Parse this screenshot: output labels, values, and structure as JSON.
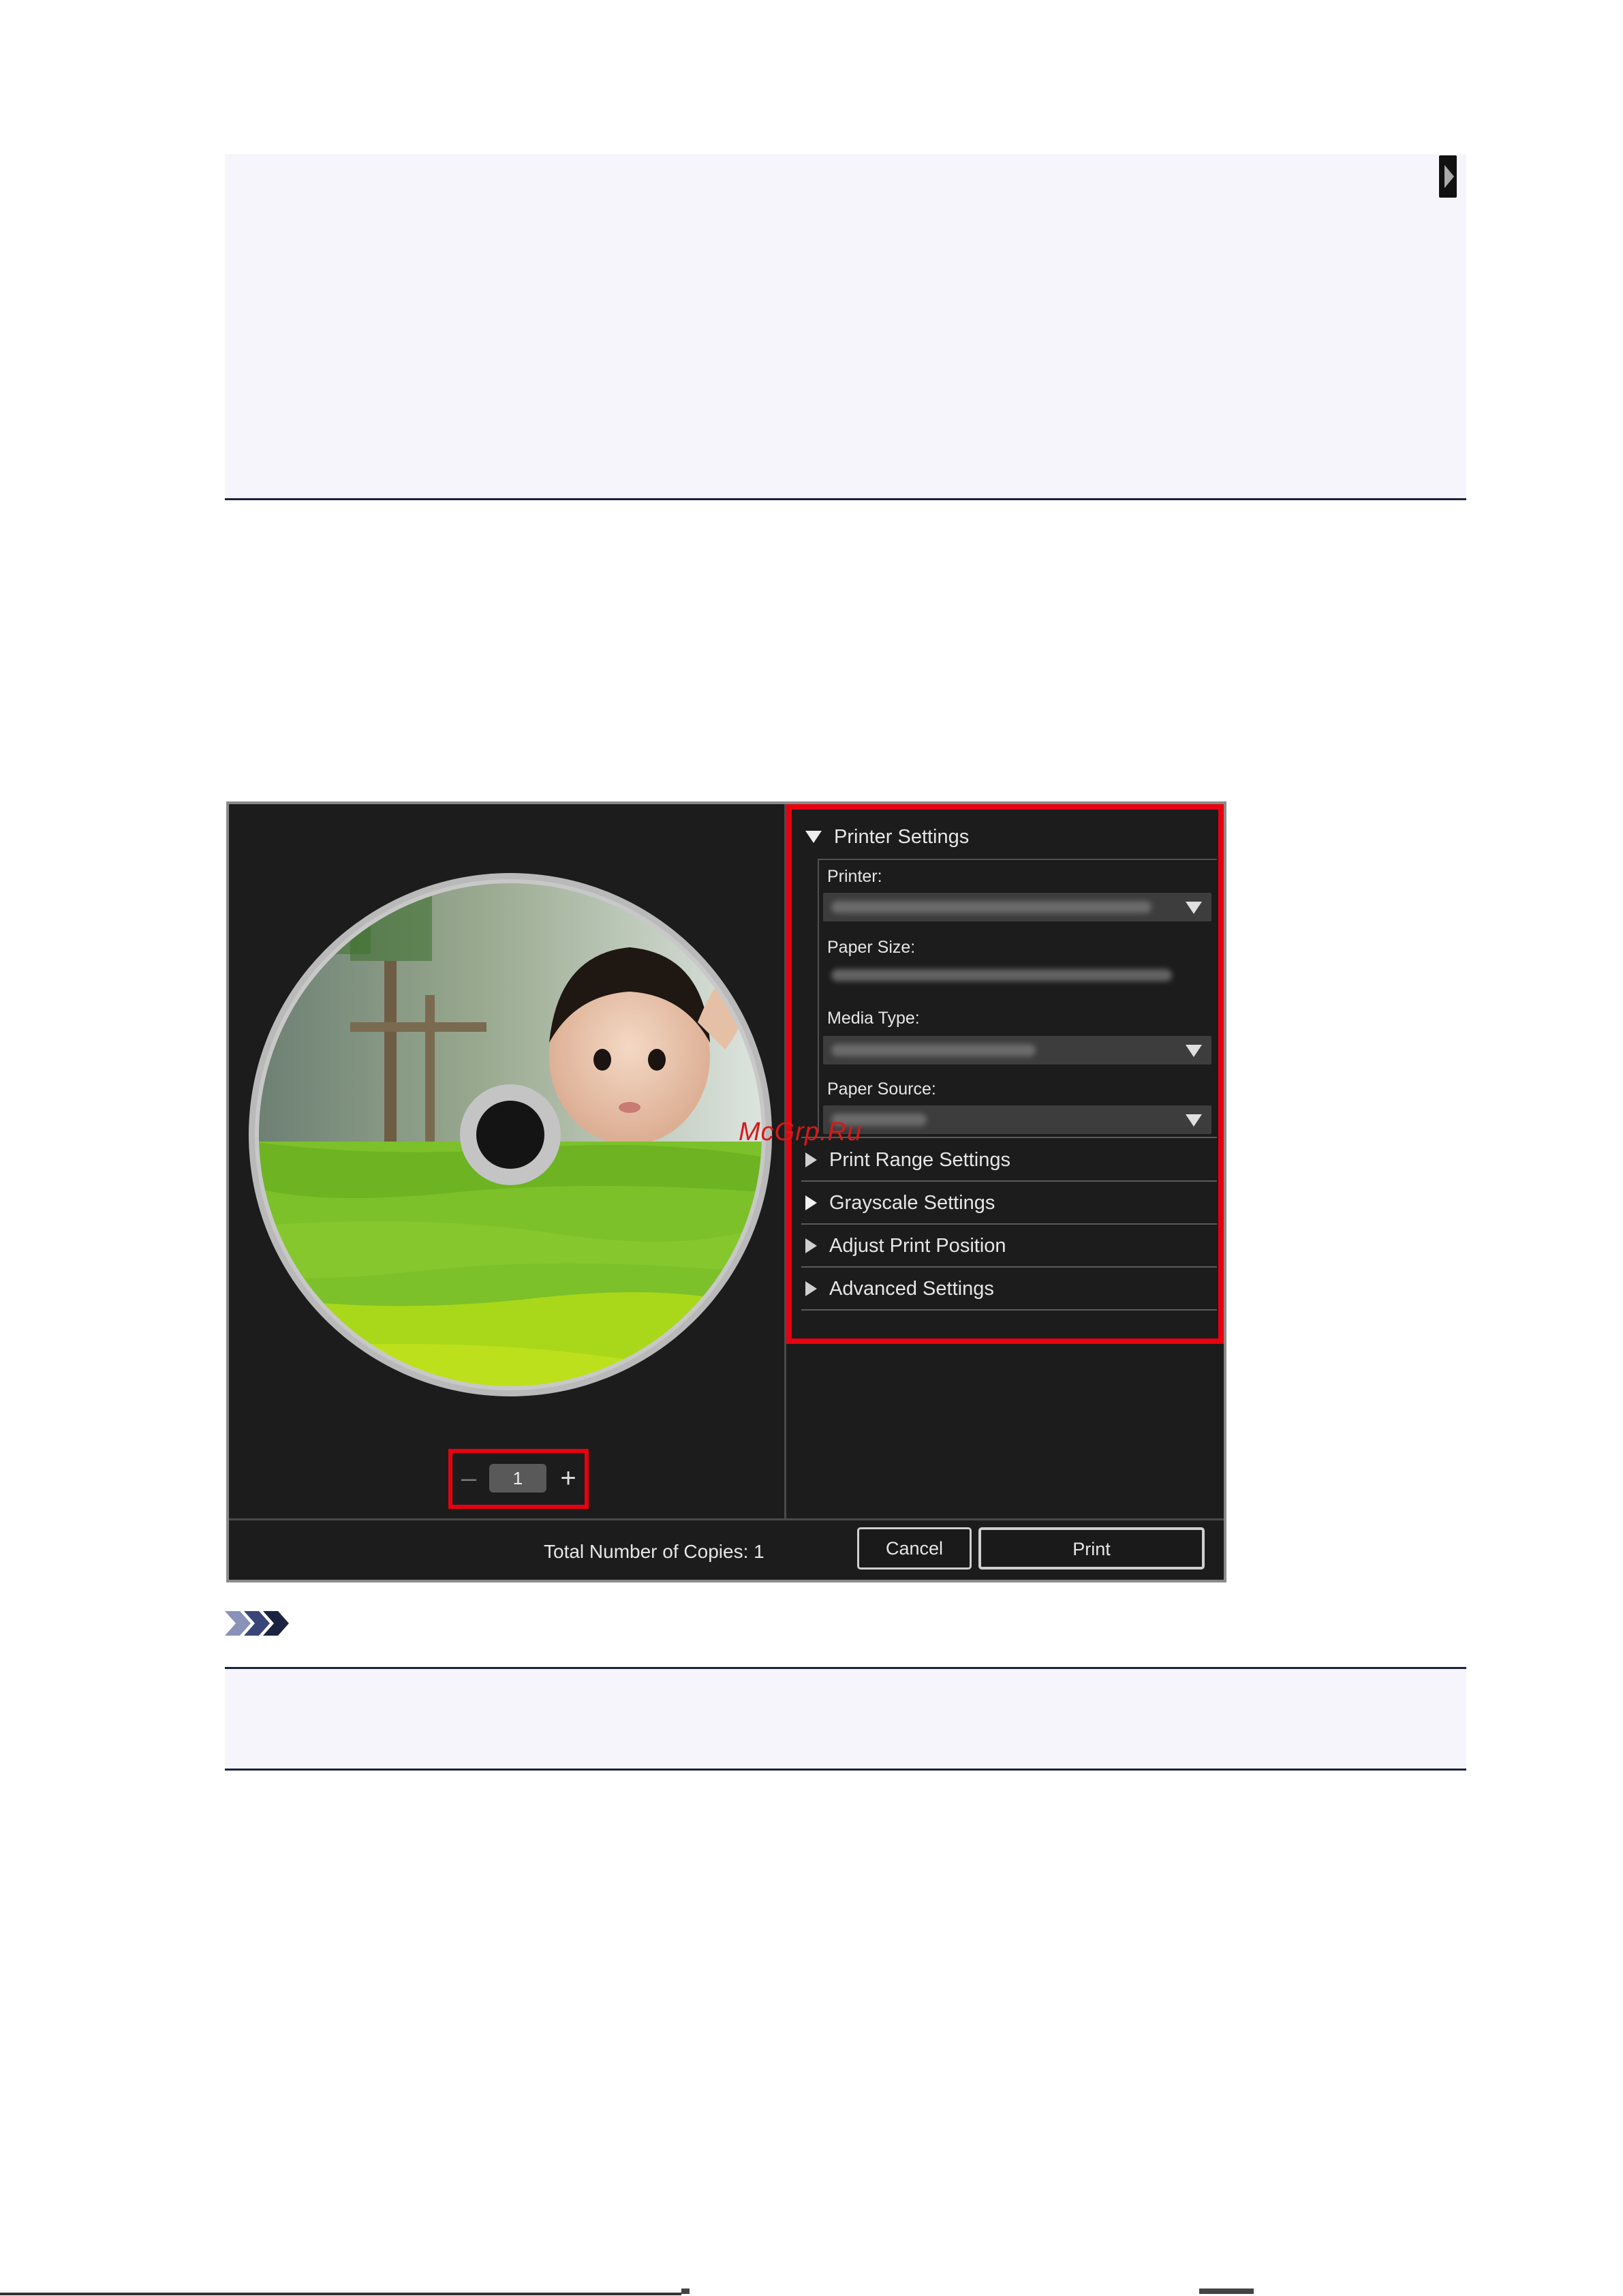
{
  "dialog": {
    "printer_settings": {
      "header": "Printer Settings",
      "printer_label": "Printer:",
      "paper_size_label": "Paper Size:",
      "media_type_label": "Media Type:",
      "paper_source_label": "Paper Source:"
    },
    "sections": [
      {
        "label": "Print Range Settings"
      },
      {
        "label": "Grayscale Settings"
      },
      {
        "label": "Adjust Print Position"
      },
      {
        "label": "Advanced Settings"
      }
    ],
    "copies": {
      "value": "1",
      "minus": "–",
      "plus": "+"
    },
    "footer": {
      "total_copies": "Total Number of Copies:  1",
      "cancel_label": "Cancel",
      "print_label": "Print"
    }
  },
  "watermark": "McGrp.Ru",
  "colors": {
    "highlight": "#e8000e",
    "dialog_bg": "#1c1c1c",
    "note_bg": "#f5f5fb",
    "note_rule": "#1b2340"
  },
  "icons": {
    "expand": "triangle-down-icon",
    "collapse": "triangle-right-icon",
    "dropdown": "chevron-down-icon",
    "note": "chevron-triple-icon"
  }
}
